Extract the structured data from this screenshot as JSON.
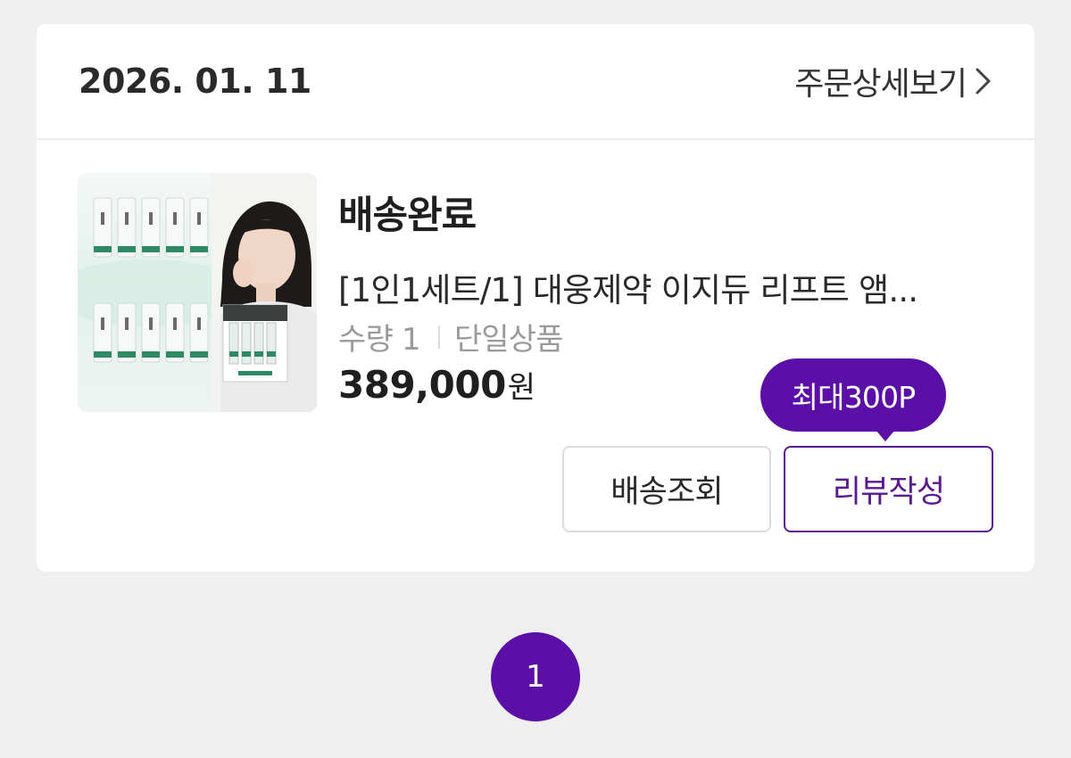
{
  "order": {
    "date": "2026. 01. 11",
    "detail_label": "주문상세보기"
  },
  "item": {
    "status": "배송완료",
    "product_name": "[1인1세트/1] 대웅제약 이지듀 리프트 앰...",
    "quantity": "수량 1",
    "option": "단일상품",
    "price_value": "389,000",
    "price_unit": "원"
  },
  "actions": {
    "track_label": "배송조회",
    "review_label": "리뷰작성",
    "points_badge": "최대300P"
  },
  "pagination": {
    "current_page": "1"
  },
  "colors": {
    "accent": "#5b0fa7",
    "review_border": "#5b1a93",
    "background": "#efefef"
  },
  "icons": {
    "detail_chevron": "chevron-right-icon"
  }
}
